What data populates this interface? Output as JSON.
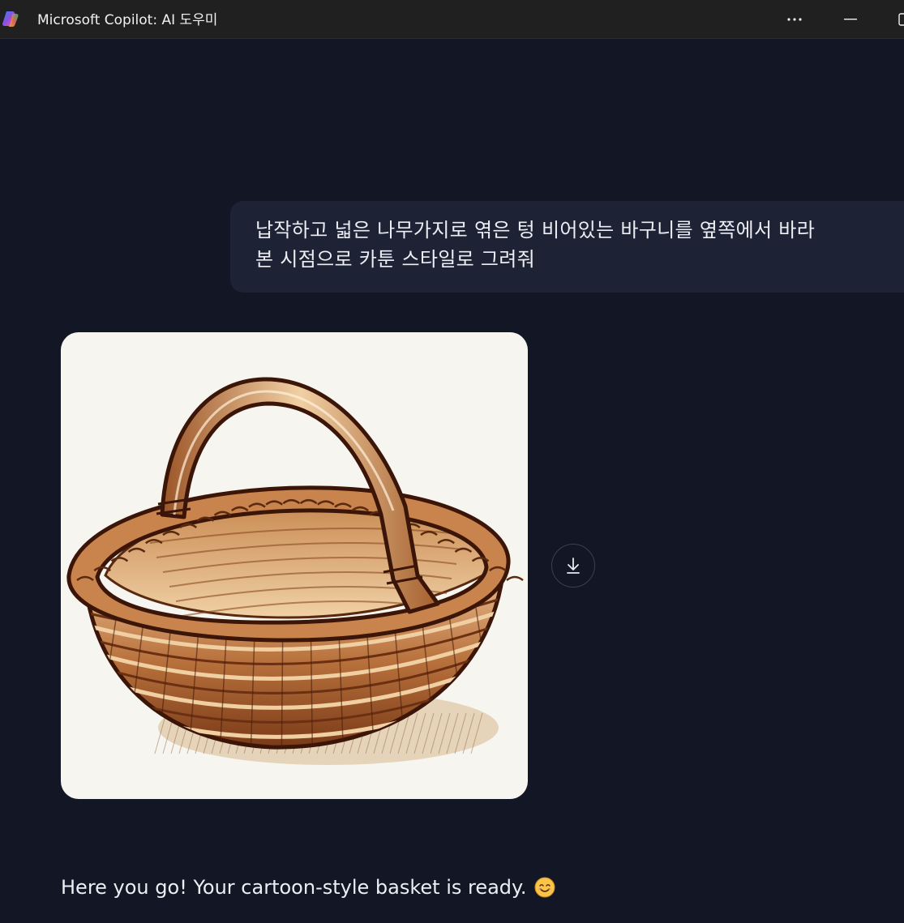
{
  "window": {
    "title": "Microsoft Copilot: AI 도우미"
  },
  "icons": {
    "app": "copilot-logo-icon",
    "more": "more-dots-icon",
    "minimize": "minimize-icon",
    "maximize": "maximize-icon",
    "download": "download-arrow-icon",
    "emoji": "smiling-face-emoji"
  },
  "chat": {
    "user_message": {
      "line1": "납작하고 넓은 나무가지로 엮은 텅 비어있는 바구니를 옆쪽에서 바라",
      "line2": "본 시점으로 카툰 스타일로 그려줘"
    },
    "assistant_reply": {
      "text": "Here you go! Your cartoon-style basket is ready."
    }
  },
  "colors": {
    "background": "#121625",
    "titlebar": "#202020",
    "user_bubble": "#1d2335",
    "image_background": "#f6f5ef",
    "basket_brown": "#a0592a",
    "outline": "#3b1608"
  }
}
